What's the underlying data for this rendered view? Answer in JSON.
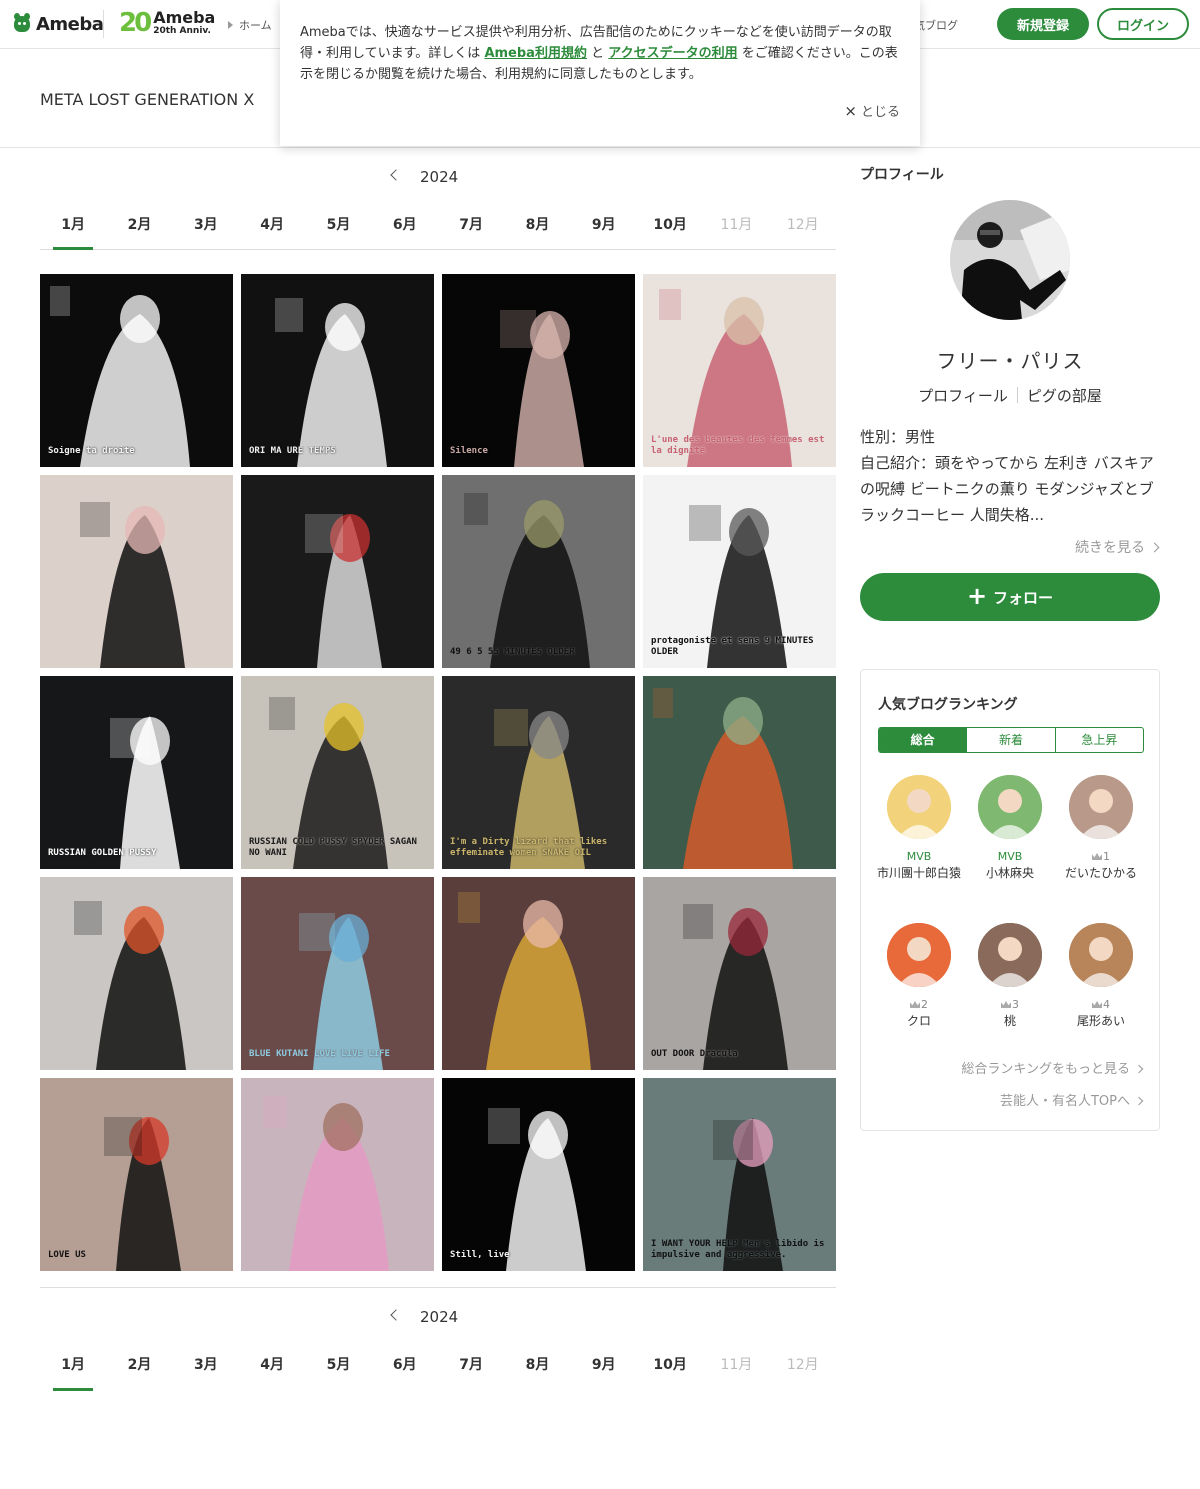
{
  "header": {
    "logo_text": "Ameba",
    "anniv_number": "20",
    "anniv_brand": "Ameba",
    "anniv_sub": "20th Anniv.",
    "breadcrumb_home": "ホーム",
    "breadcrumb_right": "気ブログ",
    "register_label": "新規登録",
    "login_label": "ログイン"
  },
  "cookie": {
    "text_before": "Amebaでは、快適なサービス提供や利用分析、広告配信のためにクッキーなどを使い訪問データの取得・利用しています。詳しくは ",
    "link1": "Ameba利用規約",
    "text_mid": " と ",
    "link2": "アクセスデータの利用",
    "text_after": " をご確認ください。この表示を閉じるか閲覧を続けた場合、利用規約に同意したものとします。",
    "close_label": "とじる"
  },
  "blog": {
    "title": "META LOST GENERATION X"
  },
  "archive": {
    "year": "2024",
    "months": [
      "1月",
      "2月",
      "3月",
      "4月",
      "5月",
      "6月",
      "7月",
      "8月",
      "9月",
      "10月",
      "11月",
      "12月"
    ],
    "active_month": 0,
    "disabled_months": [
      10,
      11
    ]
  },
  "gallery": {
    "tiles": [
      {
        "text": "Soigne ta droite",
        "bg": "#0c0c0c",
        "fg": "#f2f2f2",
        "accent": "#ffffff"
      },
      {
        "text": "ORI MA URE TEMPS",
        "bg": "#111111",
        "fg": "#eeeeee",
        "accent": "#ffffff"
      },
      {
        "text": "Silence",
        "bg": "#060606",
        "fg": "#c9a9a5",
        "accent": "#d8b4ad"
      },
      {
        "text": "L'une des beautés des femmes est la dignité",
        "bg": "#e9e2dd",
        "fg": "#c86474",
        "accent": "#d8c0a8"
      },
      {
        "text": "",
        "bg": "#dcd0cb",
        "fg": "#111111",
        "accent": "#e6b8b4"
      },
      {
        "text": "",
        "bg": "#1a1a1a",
        "fg": "#d9d9d9",
        "accent": "#c93030"
      },
      {
        "text": "49 6 5 55 MINUTES OLDER",
        "bg": "#6f6f6f",
        "fg": "#111111",
        "accent": "#9a9a6a"
      },
      {
        "text": "protagoniste et sens 9 MINUTES OLDER",
        "bg": "#f3f3f3",
        "fg": "#111111",
        "accent": "#5a5a5a"
      },
      {
        "text": "RUSSIAN GOLDEN PUSSY",
        "bg": "#151718",
        "fg": "#ffffff",
        "accent": "#ffffff"
      },
      {
        "text": "RUSSIAN COLD PUSSY SPYDER SAGAN NO WANI",
        "bg": "#c7c2ba",
        "fg": "#1a1a1a",
        "accent": "#e6c22a"
      },
      {
        "text": "I'm a Dirty lizard that likes effeminate women SNAKE OIL",
        "bg": "#2a2a2a",
        "fg": "#c9b46a",
        "accent": "#888888"
      },
      {
        "text": "",
        "bg": "#3e5a4a",
        "fg": "#d45a2a",
        "accent": "#8fb08a"
      },
      {
        "text": "",
        "bg": "#c9c6c4",
        "fg": "#0f0f0f",
        "accent": "#e0562a"
      },
      {
        "text": "BLUE KUTANI LOVE LIVE LIFE",
        "bg": "#6b4b4a",
        "fg": "#8ecbe0",
        "accent": "#6aaed6"
      },
      {
        "text": "",
        "bg": "#5a3e3c",
        "fg": "#d6a536",
        "accent": "#e8b9a8"
      },
      {
        "text": "OUT DOOR Dracula",
        "bg": "#a9a5a3",
        "fg": "#111111",
        "accent": "#9a2a3a"
      },
      {
        "text": "LOVE US",
        "bg": "#b59f94",
        "fg": "#111111",
        "accent": "#d63a2a"
      },
      {
        "text": "",
        "bg": "#c8b4bc",
        "fg": "#e59ac4",
        "accent": "#a07060"
      },
      {
        "text": "Still, live",
        "bg": "#050505",
        "fg": "#f0f0f0",
        "accent": "#ffffff"
      },
      {
        "text": "I WANT YOUR HELP Men's libido is impulsive and aggressive.",
        "bg": "#6a7c7a",
        "fg": "#111111",
        "accent": "#e8a0c0"
      }
    ]
  },
  "sidebar": {
    "heading": "プロフィール",
    "name": "フリー・パリス",
    "link_profile": "プロフィール",
    "link_room": "ピグの部屋",
    "gender": "性別：男性",
    "intro": "自己紹介：頭をやってから 左利き バスキアの呪縛 ビートニクの薫り モダンジャズとブラックコーヒー 人間失格...",
    "more": "続きを見る",
    "follow_label": "フォロー"
  },
  "ranking": {
    "title": "人気ブログランキング",
    "tabs": [
      "総合",
      "新着",
      "急上昇"
    ],
    "active_tab": 0,
    "items": [
      {
        "badge": "MVB",
        "name": "市川團十郎白猿",
        "color": "#f2d27a"
      },
      {
        "badge": "MVB",
        "name": "小林麻央",
        "color": "#7fb870"
      },
      {
        "badge": "1",
        "name": "だいたひかる",
        "color": "#b99a8a"
      },
      {
        "badge": "2",
        "name": "クロ",
        "color": "#e86a3a"
      },
      {
        "badge": "3",
        "name": "桃",
        "color": "#8a6a5a"
      },
      {
        "badge": "4",
        "name": "尾形あい",
        "color": "#b8845a"
      }
    ],
    "more_all": "総合ランキングをもっと見る",
    "more_celeb": "芸能人・有名人TOPへ"
  },
  "colors": {
    "brand": "#2d8c3c",
    "anniv": "#6cbf3c"
  }
}
